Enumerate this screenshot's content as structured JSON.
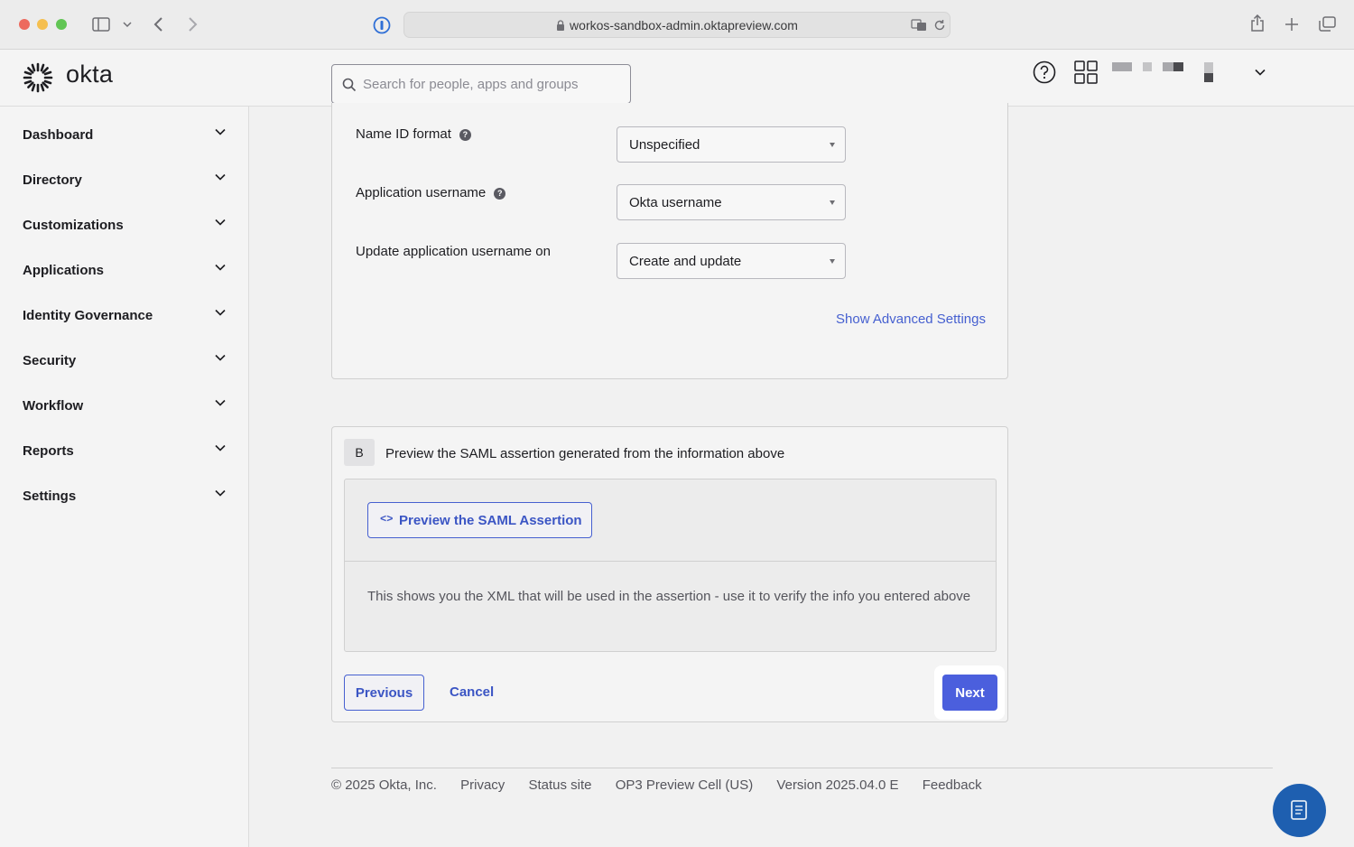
{
  "browser": {
    "url": "workos-sandbox-admin.oktapreview.com"
  },
  "header": {
    "logo_text": "okta",
    "search_placeholder": "Search for people, apps and groups"
  },
  "sidebar": {
    "items": [
      {
        "label": "Dashboard"
      },
      {
        "label": "Directory"
      },
      {
        "label": "Customizations"
      },
      {
        "label": "Applications"
      },
      {
        "label": "Identity Governance"
      },
      {
        "label": "Security"
      },
      {
        "label": "Workflow"
      },
      {
        "label": "Reports"
      },
      {
        "label": "Settings"
      }
    ]
  },
  "form": {
    "fields": [
      {
        "label": "Name ID format",
        "value": "Unspecified"
      },
      {
        "label": "Application username",
        "value": "Okta username"
      },
      {
        "label": "Update application username on",
        "value": "Create and update"
      }
    ],
    "advanced_link": "Show Advanced Settings"
  },
  "section_b": {
    "badge": "B",
    "title": "Preview the SAML assertion generated from the information above",
    "preview_button": "Preview the SAML Assertion",
    "preview_icon": "<>",
    "description": "This shows you the XML that will be used in the assertion - use it to verify the info you entered above"
  },
  "actions": {
    "previous": "Previous",
    "cancel": "Cancel",
    "next": "Next"
  },
  "footer": {
    "copyright": "© 2025 Okta, Inc.",
    "privacy": "Privacy",
    "status": "Status site",
    "cell": "OP3 Preview Cell (US)",
    "version": "Version 2025.04.0 E",
    "feedback": "Feedback"
  },
  "colors": {
    "accent": "#4b5fdd",
    "link": "#4660d0",
    "fab": "#1e5fb0"
  }
}
